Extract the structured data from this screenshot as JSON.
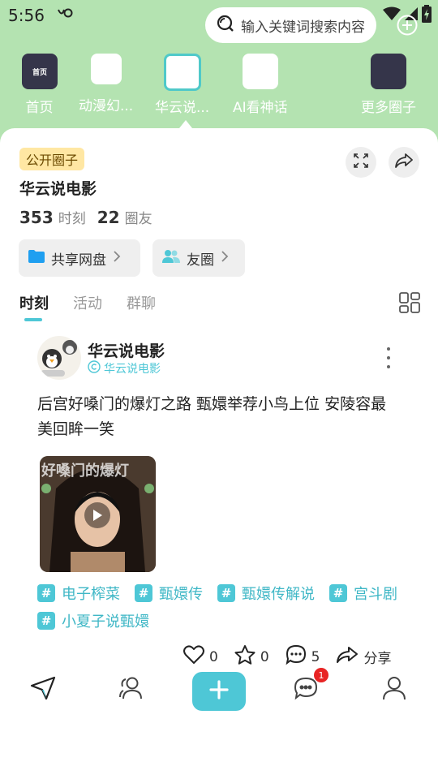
{
  "status_bar": {
    "time": "5:56",
    "icons": [
      "nfc-icon",
      "wifi-icon",
      "signal-icon",
      "battery-icon"
    ]
  },
  "search": {
    "placeholder": "输入关键词搜索内容"
  },
  "circles": [
    {
      "label": "首页",
      "thumb_text": "首页"
    },
    {
      "label": "动漫幻..."
    },
    {
      "label": "华云说...",
      "selected": true
    },
    {
      "label": "AI看神话"
    },
    {
      "label": "更多圈子"
    }
  ],
  "header": {
    "badge": "公开圈子",
    "title": "华云说电影",
    "moments_count": "353",
    "moments_label": "时刻",
    "members_count": "22",
    "members_label": "圈友"
  },
  "quick_buttons": {
    "drive": "共享网盘",
    "friends": "友圈"
  },
  "tabs": [
    "时刻",
    "活动",
    "群聊"
  ],
  "post": {
    "author": "华云说电影",
    "subtitle": "华云说电影",
    "text": "后宫好嗓门的爆灯之路 甄嬛举荐小鸟上位 安陵容最美回眸一笑",
    "video_overlay_text": "好嗓门的爆灯",
    "tags": [
      "电子榨菜",
      "甄嬛传",
      "甄嬛传解说",
      "宫斗剧",
      "小夏子说甄嬛"
    ],
    "likes": "0",
    "favorites": "0",
    "comments": "5",
    "share_label": "分享"
  },
  "bottom_nav": {
    "notification_count": "1"
  },
  "colors": {
    "accent": "#4ec7d6",
    "header_bg": "#b4e3b1",
    "badge_bg": "#ffe7a3",
    "notif": "#e82424"
  }
}
